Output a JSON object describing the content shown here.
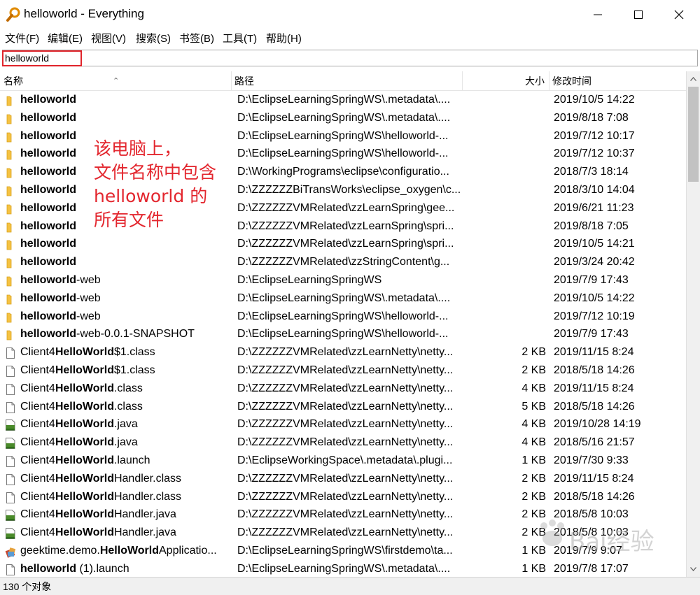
{
  "window": {
    "title": "helloworld - Everything",
    "controls": [
      "minimize",
      "maximize",
      "close"
    ]
  },
  "menu": {
    "items": [
      "文件(F)",
      "编辑(E)",
      "视图(V)",
      "搜索(S)",
      "书签(B)",
      "工具(T)",
      "帮助(H)"
    ]
  },
  "search": {
    "value": "helloworld"
  },
  "columns": {
    "name": "名称",
    "path": "路径",
    "size": "大小",
    "modified": "修改时间"
  },
  "annotation": {
    "lines": [
      "该电脑上，",
      "文件名称中包含",
      "helloworld 的",
      "所有文件"
    ],
    "color": "#e3262e"
  },
  "rows": [
    {
      "icon": "folder-icon",
      "pre": "",
      "bold": "helloworld",
      "post": "",
      "path": "D:\\EclipseLearningSpringWS\\.metadata\\....",
      "size": "",
      "date": "2019/10/5 14:22"
    },
    {
      "icon": "folder-icon",
      "pre": "",
      "bold": "helloworld",
      "post": "",
      "path": "D:\\EclipseLearningSpringWS\\.metadata\\....",
      "size": "",
      "date": "2019/8/18 7:08"
    },
    {
      "icon": "folder-icon",
      "pre": "",
      "bold": "helloworld",
      "post": "",
      "path": "D:\\EclipseLearningSpringWS\\helloworld-...",
      "size": "",
      "date": "2019/7/12 10:17"
    },
    {
      "icon": "folder-icon",
      "pre": "",
      "bold": "helloworld",
      "post": "",
      "path": "D:\\EclipseLearningSpringWS\\helloworld-...",
      "size": "",
      "date": "2019/7/12 10:37"
    },
    {
      "icon": "folder-icon",
      "pre": "",
      "bold": "helloworld",
      "post": "",
      "path": "D:\\WorkingPrograms\\eclipse\\configuratio...",
      "size": "",
      "date": "2018/7/3 18:14"
    },
    {
      "icon": "folder-icon",
      "pre": "",
      "bold": "helloworld",
      "post": "",
      "path": "D:\\ZZZZZZBiTransWorks\\eclipse_oxygen\\c...",
      "size": "",
      "date": "2018/3/10 14:04"
    },
    {
      "icon": "folder-icon",
      "pre": "",
      "bold": "helloworld",
      "post": "",
      "path": "D:\\ZZZZZZVMRelated\\zzLearnSpring\\gee...",
      "size": "",
      "date": "2019/6/21 11:23"
    },
    {
      "icon": "folder-icon",
      "pre": "",
      "bold": "helloworld",
      "post": "",
      "path": "D:\\ZZZZZZVMRelated\\zzLearnSpring\\spri...",
      "size": "",
      "date": "2019/8/18 7:05"
    },
    {
      "icon": "folder-icon",
      "pre": "",
      "bold": "helloworld",
      "post": "",
      "path": "D:\\ZZZZZZVMRelated\\zzLearnSpring\\spri...",
      "size": "",
      "date": "2019/10/5 14:21"
    },
    {
      "icon": "folder-icon",
      "pre": "",
      "bold": "helloworld",
      "post": "",
      "path": "D:\\ZZZZZZVMRelated\\zzStringContent\\g...",
      "size": "",
      "date": "2019/3/24 20:42"
    },
    {
      "icon": "folder-icon",
      "pre": "",
      "bold": "helloworld",
      "post": "-web",
      "path": "D:\\EclipseLearningSpringWS",
      "size": "",
      "date": "2019/7/9 17:43"
    },
    {
      "icon": "folder-icon",
      "pre": "",
      "bold": "helloworld",
      "post": "-web",
      "path": "D:\\EclipseLearningSpringWS\\.metadata\\....",
      "size": "",
      "date": "2019/10/5 14:22"
    },
    {
      "icon": "folder-icon",
      "pre": "",
      "bold": "helloworld",
      "post": "-web",
      "path": "D:\\EclipseLearningSpringWS\\helloworld-...",
      "size": "",
      "date": "2019/7/12 10:19"
    },
    {
      "icon": "folder-icon",
      "pre": "",
      "bold": "helloworld",
      "post": "-web-0.0.1-SNAPSHOT",
      "path": "D:\\EclipseLearningSpringWS\\helloworld-...",
      "size": "",
      "date": "2019/7/9 17:43"
    },
    {
      "icon": "file-icon",
      "pre": "Client4",
      "bold": "HelloWorld",
      "post": "$1.class",
      "path": "D:\\ZZZZZZVMRelated\\zzLearnNetty\\netty...",
      "size": "2 KB",
      "date": "2019/11/15 8:24"
    },
    {
      "icon": "file-icon",
      "pre": "Client4",
      "bold": "HelloWorld",
      "post": "$1.class",
      "path": "D:\\ZZZZZZVMRelated\\zzLearnNetty\\netty...",
      "size": "2 KB",
      "date": "2018/5/18 14:26"
    },
    {
      "icon": "file-icon",
      "pre": "Client4",
      "bold": "HelloWorld",
      "post": ".class",
      "path": "D:\\ZZZZZZVMRelated\\zzLearnNetty\\netty...",
      "size": "4 KB",
      "date": "2019/11/15 8:24"
    },
    {
      "icon": "file-icon",
      "pre": "Client4",
      "bold": "HelloWorld",
      "post": ".class",
      "path": "D:\\ZZZZZZVMRelated\\zzLearnNetty\\netty...",
      "size": "5 KB",
      "date": "2018/5/18 14:26"
    },
    {
      "icon": "java-file-icon",
      "pre": "Client4",
      "bold": "HelloWorld",
      "post": ".java",
      "path": "D:\\ZZZZZZVMRelated\\zzLearnNetty\\netty...",
      "size": "4 KB",
      "date": "2019/10/28 14:19"
    },
    {
      "icon": "java-file-icon",
      "pre": "Client4",
      "bold": "HelloWorld",
      "post": ".java",
      "path": "D:\\ZZZZZZVMRelated\\zzLearnNetty\\netty...",
      "size": "4 KB",
      "date": "2018/5/16 21:57"
    },
    {
      "icon": "file-icon",
      "pre": "Client4",
      "bold": "HelloWorld",
      "post": ".launch",
      "path": "D:\\EclipseWorkingSpace\\.metadata\\.plugi...",
      "size": "1 KB",
      "date": "2019/7/30 9:33"
    },
    {
      "icon": "file-icon",
      "pre": "Client4",
      "bold": "HelloWorld",
      "post": "Handler.class",
      "path": "D:\\ZZZZZZVMRelated\\zzLearnNetty\\netty...",
      "size": "2 KB",
      "date": "2019/11/15 8:24"
    },
    {
      "icon": "file-icon",
      "pre": "Client4",
      "bold": "HelloWorld",
      "post": "Handler.class",
      "path": "D:\\ZZZZZZVMRelated\\zzLearnNetty\\netty...",
      "size": "2 KB",
      "date": "2018/5/18 14:26"
    },
    {
      "icon": "java-file-icon",
      "pre": "Client4",
      "bold": "HelloWorld",
      "post": "Handler.java",
      "path": "D:\\ZZZZZZVMRelated\\zzLearnNetty\\netty...",
      "size": "2 KB",
      "date": "2018/5/8 10:03"
    },
    {
      "icon": "java-file-icon",
      "pre": "Client4",
      "bold": "HelloWorld",
      "post": "Handler.java",
      "path": "D:\\ZZZZZZVMRelated\\zzLearnNetty\\netty...",
      "size": "2 KB",
      "date": "2018/5/8 10:03"
    },
    {
      "icon": "jar-file-icon",
      "pre": "geektime.demo.",
      "bold": "HelloWorld",
      "post": "Applicatio...",
      "path": "D:\\EclipseLearningSpringWS\\firstdemo\\ta...",
      "size": "1 KB",
      "date": "2019/7/9 9:07"
    },
    {
      "icon": "file-icon",
      "pre": "",
      "bold": "helloworld",
      "post": " (1).launch",
      "path": "D:\\EclipseLearningSpringWS\\.metadata\\....",
      "size": "1 KB",
      "date": "2019/7/8 17:07"
    }
  ],
  "status": {
    "text": "130 个对象"
  },
  "watermark": {
    "text": "Bai经验"
  },
  "colors": {
    "folder": "#f5c242",
    "highlight_box": "#e0242b",
    "annotation": "#e3262e"
  }
}
